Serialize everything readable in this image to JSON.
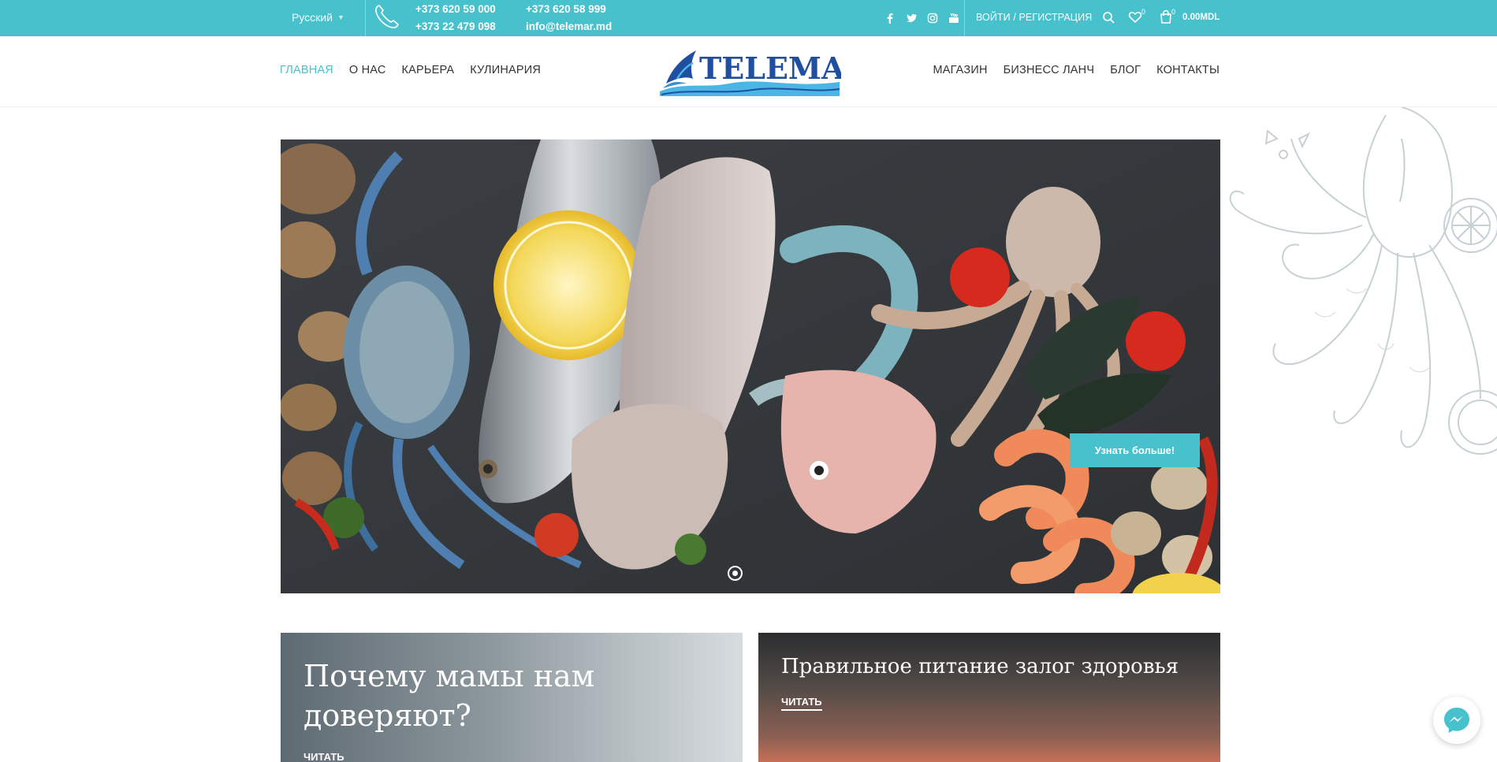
{
  "topbar": {
    "language": "Русский",
    "phones": {
      "col1": [
        "+373 620 59 000",
        "+373 22 479 098"
      ],
      "col2_phone": "+373 620 58 999",
      "email": "info@telemar.md"
    },
    "social_icons": [
      "facebook-icon",
      "twitter-icon",
      "instagram-icon",
      "youtube-icon"
    ],
    "login_label": "ВОЙТИ / РЕГИСТРАЦИЯ",
    "wishlist_count": "0",
    "cart_count": "0",
    "cart_total": "0.00MDL"
  },
  "header": {
    "logo_text": "TELEMAR",
    "nav_left": [
      "ГЛАВНАЯ",
      "О НАС",
      "КАРЬЕРА",
      "КУЛИНАРИЯ"
    ],
    "nav_right": [
      "МАГАЗИН",
      "БИЗНЕСС ЛАНЧ",
      "БЛОГ",
      "КОНТАКТЫ"
    ],
    "active_item": "ГЛАВНАЯ"
  },
  "hero": {
    "button_label": "Узнать больше!"
  },
  "cards": [
    {
      "title": "Почему мамы нам доверяют?",
      "read_label": "ЧИТАТЬ"
    },
    {
      "title": "Правильное питание залог здоровья",
      "read_label": "ЧИТАТЬ"
    }
  ],
  "colors": {
    "accent": "#47c1cc",
    "logo_blue": "#1f4fa0"
  }
}
